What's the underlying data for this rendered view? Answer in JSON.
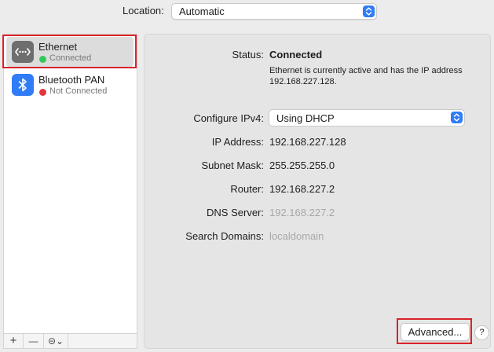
{
  "location": {
    "label": "Location:",
    "value": "Automatic"
  },
  "services": [
    {
      "name": "Ethernet",
      "status": "Connected",
      "status_color": "#34c759",
      "icon": "ethernet-icon",
      "selected": true
    },
    {
      "name": "Bluetooth PAN",
      "status": "Not Connected",
      "status_color": "#e0373d",
      "icon": "bluetooth-icon",
      "selected": false
    }
  ],
  "toolbar": {
    "add": "+",
    "remove": "—",
    "actions": "⊝⌄"
  },
  "details": {
    "status_label": "Status:",
    "status_value": "Connected",
    "status_desc": "Ethernet is currently active and has the IP address 192.168.227.128.",
    "ipv4_label": "Configure IPv4:",
    "ipv4_value": "Using DHCP",
    "ip_label": "IP Address:",
    "ip_value": "192.168.227.128",
    "subnet_label": "Subnet Mask:",
    "subnet_value": "255.255.255.0",
    "router_label": "Router:",
    "router_value": "192.168.227.2",
    "dns_label": "DNS Server:",
    "dns_value": "192.168.227.2",
    "search_label": "Search Domains:",
    "search_value": "localdomain"
  },
  "buttons": {
    "advanced": "Advanced...",
    "help": "?"
  },
  "colors": {
    "accent": "#2f7cf6",
    "highlight": "#d8232a"
  }
}
